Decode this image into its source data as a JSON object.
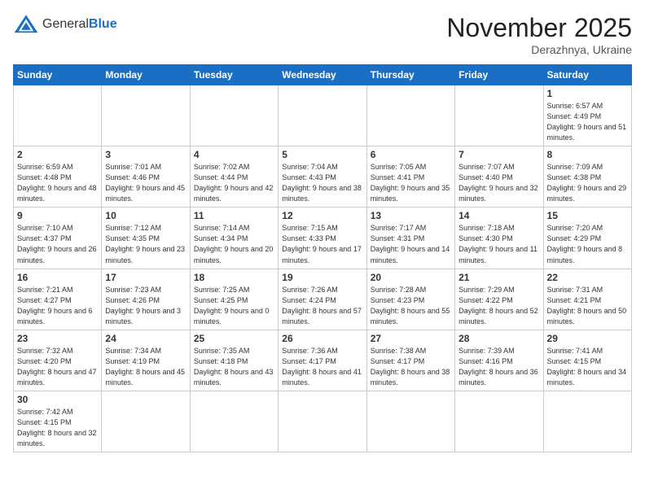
{
  "header": {
    "logo_general": "General",
    "logo_blue": "Blue",
    "month_title": "November 2025",
    "subtitle": "Derazhnya, Ukraine"
  },
  "weekdays": [
    "Sunday",
    "Monday",
    "Tuesday",
    "Wednesday",
    "Thursday",
    "Friday",
    "Saturday"
  ],
  "weeks": [
    [
      {
        "day": "",
        "info": ""
      },
      {
        "day": "",
        "info": ""
      },
      {
        "day": "",
        "info": ""
      },
      {
        "day": "",
        "info": ""
      },
      {
        "day": "",
        "info": ""
      },
      {
        "day": "",
        "info": ""
      },
      {
        "day": "1",
        "info": "Sunrise: 6:57 AM\nSunset: 4:49 PM\nDaylight: 9 hours\nand 51 minutes."
      }
    ],
    [
      {
        "day": "2",
        "info": "Sunrise: 6:59 AM\nSunset: 4:48 PM\nDaylight: 9 hours\nand 48 minutes."
      },
      {
        "day": "3",
        "info": "Sunrise: 7:01 AM\nSunset: 4:46 PM\nDaylight: 9 hours\nand 45 minutes."
      },
      {
        "day": "4",
        "info": "Sunrise: 7:02 AM\nSunset: 4:44 PM\nDaylight: 9 hours\nand 42 minutes."
      },
      {
        "day": "5",
        "info": "Sunrise: 7:04 AM\nSunset: 4:43 PM\nDaylight: 9 hours\nand 38 minutes."
      },
      {
        "day": "6",
        "info": "Sunrise: 7:05 AM\nSunset: 4:41 PM\nDaylight: 9 hours\nand 35 minutes."
      },
      {
        "day": "7",
        "info": "Sunrise: 7:07 AM\nSunset: 4:40 PM\nDaylight: 9 hours\nand 32 minutes."
      },
      {
        "day": "8",
        "info": "Sunrise: 7:09 AM\nSunset: 4:38 PM\nDaylight: 9 hours\nand 29 minutes."
      }
    ],
    [
      {
        "day": "9",
        "info": "Sunrise: 7:10 AM\nSunset: 4:37 PM\nDaylight: 9 hours\nand 26 minutes."
      },
      {
        "day": "10",
        "info": "Sunrise: 7:12 AM\nSunset: 4:35 PM\nDaylight: 9 hours\nand 23 minutes."
      },
      {
        "day": "11",
        "info": "Sunrise: 7:14 AM\nSunset: 4:34 PM\nDaylight: 9 hours\nand 20 minutes."
      },
      {
        "day": "12",
        "info": "Sunrise: 7:15 AM\nSunset: 4:33 PM\nDaylight: 9 hours\nand 17 minutes."
      },
      {
        "day": "13",
        "info": "Sunrise: 7:17 AM\nSunset: 4:31 PM\nDaylight: 9 hours\nand 14 minutes."
      },
      {
        "day": "14",
        "info": "Sunrise: 7:18 AM\nSunset: 4:30 PM\nDaylight: 9 hours\nand 11 minutes."
      },
      {
        "day": "15",
        "info": "Sunrise: 7:20 AM\nSunset: 4:29 PM\nDaylight: 9 hours\nand 8 minutes."
      }
    ],
    [
      {
        "day": "16",
        "info": "Sunrise: 7:21 AM\nSunset: 4:27 PM\nDaylight: 9 hours\nand 6 minutes."
      },
      {
        "day": "17",
        "info": "Sunrise: 7:23 AM\nSunset: 4:26 PM\nDaylight: 9 hours\nand 3 minutes."
      },
      {
        "day": "18",
        "info": "Sunrise: 7:25 AM\nSunset: 4:25 PM\nDaylight: 9 hours\nand 0 minutes."
      },
      {
        "day": "19",
        "info": "Sunrise: 7:26 AM\nSunset: 4:24 PM\nDaylight: 8 hours\nand 57 minutes."
      },
      {
        "day": "20",
        "info": "Sunrise: 7:28 AM\nSunset: 4:23 PM\nDaylight: 8 hours\nand 55 minutes."
      },
      {
        "day": "21",
        "info": "Sunrise: 7:29 AM\nSunset: 4:22 PM\nDaylight: 8 hours\nand 52 minutes."
      },
      {
        "day": "22",
        "info": "Sunrise: 7:31 AM\nSunset: 4:21 PM\nDaylight: 8 hours\nand 50 minutes."
      }
    ],
    [
      {
        "day": "23",
        "info": "Sunrise: 7:32 AM\nSunset: 4:20 PM\nDaylight: 8 hours\nand 47 minutes."
      },
      {
        "day": "24",
        "info": "Sunrise: 7:34 AM\nSunset: 4:19 PM\nDaylight: 8 hours\nand 45 minutes."
      },
      {
        "day": "25",
        "info": "Sunrise: 7:35 AM\nSunset: 4:18 PM\nDaylight: 8 hours\nand 43 minutes."
      },
      {
        "day": "26",
        "info": "Sunrise: 7:36 AM\nSunset: 4:17 PM\nDaylight: 8 hours\nand 41 minutes."
      },
      {
        "day": "27",
        "info": "Sunrise: 7:38 AM\nSunset: 4:17 PM\nDaylight: 8 hours\nand 38 minutes."
      },
      {
        "day": "28",
        "info": "Sunrise: 7:39 AM\nSunset: 4:16 PM\nDaylight: 8 hours\nand 36 minutes."
      },
      {
        "day": "29",
        "info": "Sunrise: 7:41 AM\nSunset: 4:15 PM\nDaylight: 8 hours\nand 34 minutes."
      }
    ],
    [
      {
        "day": "30",
        "info": "Sunrise: 7:42 AM\nSunset: 4:15 PM\nDaylight: 8 hours\nand 32 minutes."
      },
      {
        "day": "",
        "info": ""
      },
      {
        "day": "",
        "info": ""
      },
      {
        "day": "",
        "info": ""
      },
      {
        "day": "",
        "info": ""
      },
      {
        "day": "",
        "info": ""
      },
      {
        "day": "",
        "info": ""
      }
    ]
  ]
}
